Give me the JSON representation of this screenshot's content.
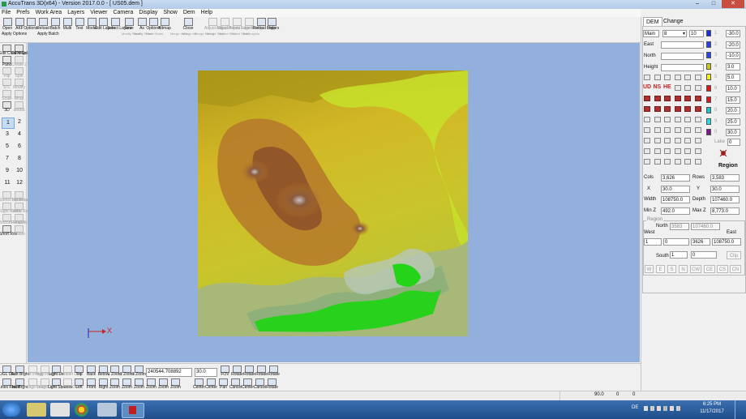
{
  "window": {
    "title": "AccuTrans 3D(x64) - Version 2017.0.0 - [ US05.dem ]",
    "buttons": [
      "–",
      "□",
      "✕"
    ]
  },
  "menu": [
    "File",
    "Prefs",
    "Work Area",
    "Layers",
    "Viewer",
    "Camera",
    "Display",
    "Show",
    "Dem",
    "Help"
  ],
  "toolbar": {
    "buttons": [
      {
        "label": "Open",
        "disabled": false
      },
      {
        "label": "AKF",
        "disabled": false
      },
      {
        "label": "Options",
        "disabled": false
      },
      {
        "label": "Reload",
        "disabled": false
      },
      {
        "label": "Batch",
        "disabled": false
      },
      {
        "label": "Multi",
        "disabled": false
      },
      {
        "label": "Text",
        "disabled": false
      },
      {
        "label": "Model",
        "disabled": false
      },
      {
        "label": "Edit Layers",
        "disabled": false
      },
      {
        "label": "Select Layers",
        "disabled": false
      },
      {
        "label": "Save",
        "disabled": false
      },
      {
        "label": "As",
        "disabled": false
      },
      {
        "label": "Options",
        "disabled": false
      },
      {
        "label": "Bitmap",
        "disabled": false
      },
      {
        "label": "Close",
        "disabled": false
      },
      {
        "label": "Adjust Object",
        "disabled": true
      },
      {
        "label": "Adjust Points",
        "disabled": true
      },
      {
        "label": "Adjust Layers",
        "disabled": true
      },
      {
        "label": "Edge Ready",
        "disabled": true
      },
      {
        "label": "Reload Layers",
        "disabled": false
      },
      {
        "label": "Help",
        "disabled": false
      }
    ],
    "row2_left": [
      "Apply Options",
      "Apply Batch"
    ],
    "row2_mid": [
      "Modify Sheet",
      "Modify Sheet",
      "Fixed Sheet"
    ],
    "row2_merge": [
      "Merge Verts",
      "Merge All",
      "Merge Select",
      "Merge Save"
    ],
    "row2_misc": [
      "Select Grid",
      "Select Sheet",
      "Edit Layers"
    ]
  },
  "left_tools": {
    "top": [
      {
        "label": "Edit Color Map",
        "disabled": false
      },
      {
        "label": "DEM Color Map",
        "disabled": false
      },
      {
        "label": "Pano",
        "disabled": false
      },
      {
        "label": "Create LTN",
        "disabled": true
      },
      {
        "label": "Flip",
        "disabled": true
      },
      {
        "label": "Spin",
        "disabled": true
      },
      {
        "label": "STL",
        "disabled": true
      },
      {
        "label": "Modify",
        "disabled": true
      },
      {
        "label": "Scale",
        "disabled": true
      },
      {
        "label": "Wrap",
        "disabled": true
      },
      {
        "label": "3D",
        "disabled": false
      },
      {
        "label": "anidat",
        "disabled": true
      }
    ],
    "views": [
      "1",
      "2",
      "3",
      "4",
      "5",
      "6",
      "7",
      "8",
      "9",
      "10",
      "11",
      "12"
    ],
    "bottom": [
      {
        "label": "Stereo Rotate",
        "disabled": true
      },
      {
        "label": "Top Rotate",
        "disabled": true
      },
      {
        "label": "Right Rotate",
        "disabled": true
      },
      {
        "label": "Ortho Rotate",
        "disabled": true
      },
      {
        "label": "Bottom Rotate",
        "disabled": true
      },
      {
        "label": "Persp Rotate",
        "disabled": true
      },
      {
        "label": "Short Roll",
        "disabled": false
      },
      {
        "label": "Rotate",
        "disabled": true
      }
    ]
  },
  "viewport": {
    "background": "#93b0dc",
    "axis_label": "X",
    "axis_color": "#cc2222"
  },
  "bottom_toolbar": {
    "row1": [
      {
        "label": "OGL ON",
        "disabled": false
      },
      {
        "label": "Edit Brght",
        "disabled": false
      },
      {
        "label": "Edit Image",
        "disabled": true
      },
      {
        "label": "Bkg Image",
        "disabled": true
      },
      {
        "label": "Light Dir",
        "disabled": false
      },
      {
        "label": "Parallel OFF",
        "disabled": true
      },
      {
        "label": "Top",
        "disabled": false
      },
      {
        "label": "Back",
        "disabled": false
      },
      {
        "label": "Below",
        "disabled": false
      },
      {
        "label": "1 Zoom",
        "disabled": false
      },
      {
        "label": "2 Zoom",
        "disabled": false
      },
      {
        "label": "3 Zoom",
        "disabled": false
      }
    ],
    "row2": [
      {
        "label": "Lines Reset",
        "disabled": false
      },
      {
        "label": "No Brght",
        "disabled": false
      },
      {
        "label": "Image OFF",
        "disabled": true
      },
      {
        "label": "Image OFF",
        "disabled": true
      },
      {
        "label": "Light Shadow",
        "disabled": false
      },
      {
        "label": "Quads OFF",
        "disabled": true
      },
      {
        "label": "Left",
        "disabled": false
      },
      {
        "label": "Front",
        "disabled": false
      },
      {
        "label": "Right",
        "disabled": false
      },
      {
        "label": "Zoom",
        "disabled": false
      },
      {
        "label": "Zoom",
        "disabled": false
      },
      {
        "label": "Zoom",
        "disabled": false
      },
      {
        "label": "Zoom",
        "disabled": false
      },
      {
        "label": "Zoom",
        "disabled": false
      },
      {
        "label": "Zoom",
        "disabled": false
      }
    ],
    "coords_value": "240544.708892",
    "fov_value": "30.0",
    "right_row1": [
      {
        "label": "FOV",
        "disabled": false
      },
      {
        "label": "Rotate",
        "disabled": false
      },
      {
        "label": "Rotate",
        "disabled": false
      },
      {
        "label": "Rotate",
        "disabled": false
      },
      {
        "label": "Rotate",
        "disabled": false
      }
    ],
    "right_row2": [
      {
        "label": "Center",
        "disabled": false
      },
      {
        "label": "Center",
        "disabled": false
      },
      {
        "label": "Pan",
        "disabled": false
      },
      {
        "label": "Cancel",
        "disabled": false
      },
      {
        "label": "Center",
        "disabled": false
      },
      {
        "label": "Cancel",
        "disabled": false
      },
      {
        "label": "Rotate",
        "disabled": false
      }
    ]
  },
  "right_panel": {
    "tabs": [
      "DEM",
      "Change"
    ],
    "main_label": "Main",
    "main_select": "8",
    "main_count": "10",
    "east_label": "East",
    "north_label": "North",
    "height_label": "Height",
    "color_rows": [
      {
        "n": "1",
        "value": "-30.0",
        "color": "#1a2fd6"
      },
      {
        "n": "2",
        "value": "-20.0",
        "color": "#2a40e0"
      },
      {
        "n": "3",
        "value": "-10.0",
        "color": "#2c46e2"
      },
      {
        "n": "4",
        "value": "3.0",
        "color": "#c8c81e"
      },
      {
        "n": "5",
        "value": "5.0",
        "color": "#f3f319"
      },
      {
        "n": "6",
        "value": "10.0",
        "color": "#d61a1a"
      },
      {
        "n": "7",
        "value": "15.0",
        "color": "#d61a1a"
      },
      {
        "n": "8",
        "value": "20.0",
        "color": "#21c0c0"
      },
      {
        "n": "9",
        "value": "25.0",
        "color": "#2ad8e0"
      },
      {
        "n": "0",
        "value": "30.0",
        "color": "#7a1a8a"
      }
    ],
    "icon_labels": [
      "UD",
      "NS",
      "HE"
    ],
    "lake_label": "Lake",
    "lake_value": "0",
    "region_button": "Region",
    "cols_label": "Cols",
    "cols_value": "3,626",
    "rows_label": "Rows",
    "rows_value": "3,583",
    "x_label": "X",
    "x_value": "30.0",
    "y_label": "Y",
    "y_value": "30.0",
    "width_label": "Width",
    "width_value": "108750.0",
    "depth_label": "Depth",
    "depth_value": "107460.0",
    "minz_label": "Min Z",
    "minz_value": "492.0",
    "maxz_label": "Max Z",
    "maxz_value": "8,773.0",
    "region_group": "Region",
    "region_north_label": "North",
    "region_north_a": "3583",
    "region_north_b": "107460.0",
    "region_west_label": "West",
    "region_east_label": "East",
    "region_west_a": "1",
    "region_west_b": "0",
    "region_east_a": "3626",
    "region_east_b": "108750.0",
    "region_south_label": "South",
    "region_south_a": "1",
    "region_south_b": "0",
    "clip_button": "Clip",
    "direction_buttons": [
      "W",
      "E",
      "S",
      "N",
      "CW",
      "CE",
      "CS",
      "CN"
    ]
  },
  "status_bar": {
    "fov": "90.0",
    "a": "0",
    "b": "0"
  },
  "taskbar": {
    "lang": "DE",
    "time": "6:25 PM",
    "date": "11/17/2017"
  }
}
